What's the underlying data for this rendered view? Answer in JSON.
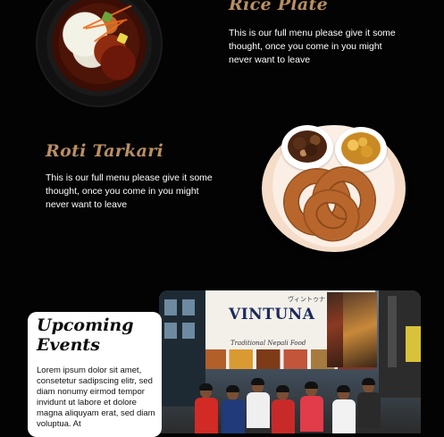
{
  "menu": {
    "items": [
      {
        "title": "Rice Plate",
        "description": "This is our full menu please give it some thought, once you come in you might never want to leave"
      },
      {
        "title": "Roti Tarkari",
        "description": "This is our full menu please give it some thought, once you come in you might never want to leave"
      }
    ]
  },
  "events": {
    "title": "Upcoming Events",
    "body": "Lorem ipsum dolor sit amet, consetetur sadipscing elitr, sed diam nonumy eirmod tempor invidunt ut labore et dolore magna aliquyam erat, sed diam voluptua. At"
  },
  "photo": {
    "banner_japanese": "ヴィントゥナ",
    "banner_brand": "VINTUNA",
    "banner_tagline": "Traditional Nepali Food"
  },
  "colors": {
    "background": "#030303",
    "title_accent": "#b98f64",
    "card_bg": "#ffffff"
  }
}
